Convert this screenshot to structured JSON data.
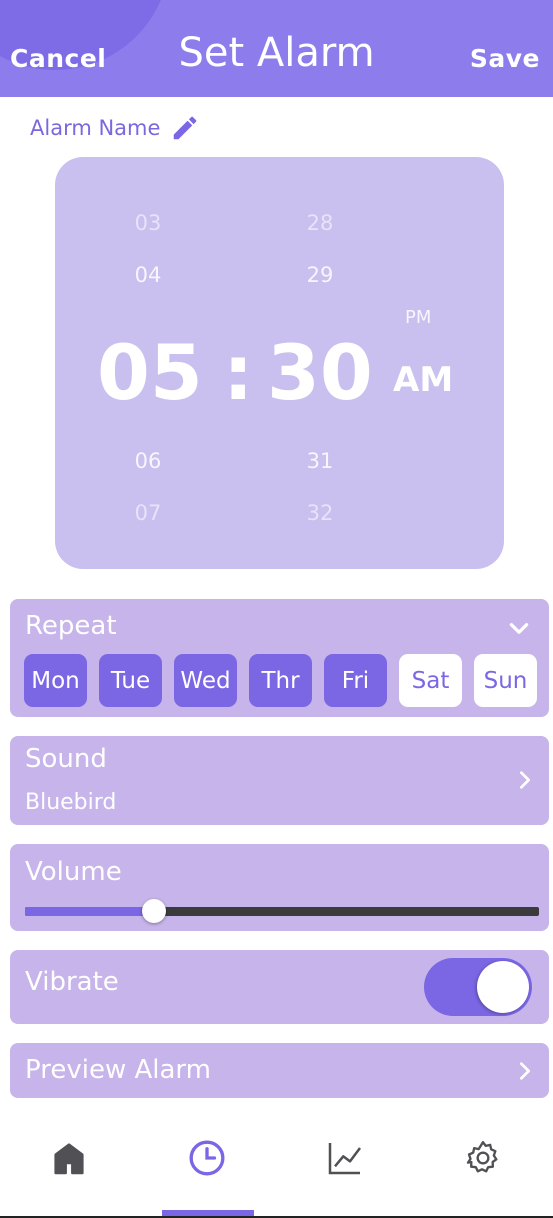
{
  "header": {
    "cancel_label": "Cancel",
    "title": "Set Alarm",
    "save_label": "Save"
  },
  "alarm_name": {
    "label": "Alarm Name",
    "icon": "pencil-icon"
  },
  "time_picker": {
    "hours_above": [
      "03",
      "04"
    ],
    "hour": "05",
    "hours_below": [
      "06",
      "07"
    ],
    "separator": ":",
    "minutes_above": [
      "28",
      "29"
    ],
    "minute": "30",
    "minutes_below": [
      "31",
      "32"
    ],
    "period_other": "PM",
    "period": "AM"
  },
  "repeat": {
    "label": "Repeat",
    "days": [
      {
        "label": "Mon",
        "selected": true
      },
      {
        "label": "Tue",
        "selected": true
      },
      {
        "label": "Wed",
        "selected": true
      },
      {
        "label": "Thr",
        "selected": true
      },
      {
        "label": "Fri",
        "selected": true
      },
      {
        "label": "Sat",
        "selected": false
      },
      {
        "label": "Sun",
        "selected": false
      }
    ]
  },
  "sound": {
    "label": "Sound",
    "value": "Bluebird"
  },
  "volume": {
    "label": "Volume",
    "level": 0.25
  },
  "vibrate": {
    "label": "Vibrate",
    "enabled": true
  },
  "preview": {
    "label": "Preview Alarm"
  },
  "bottom_nav": {
    "items": [
      "home-icon",
      "clock-icon",
      "chart-icon",
      "gear-icon"
    ],
    "active": 1
  },
  "colors": {
    "accent": "#7b66e4",
    "header": "#8d7ceb",
    "card": "#c6b4ea",
    "picker": "#c9c0ef"
  }
}
